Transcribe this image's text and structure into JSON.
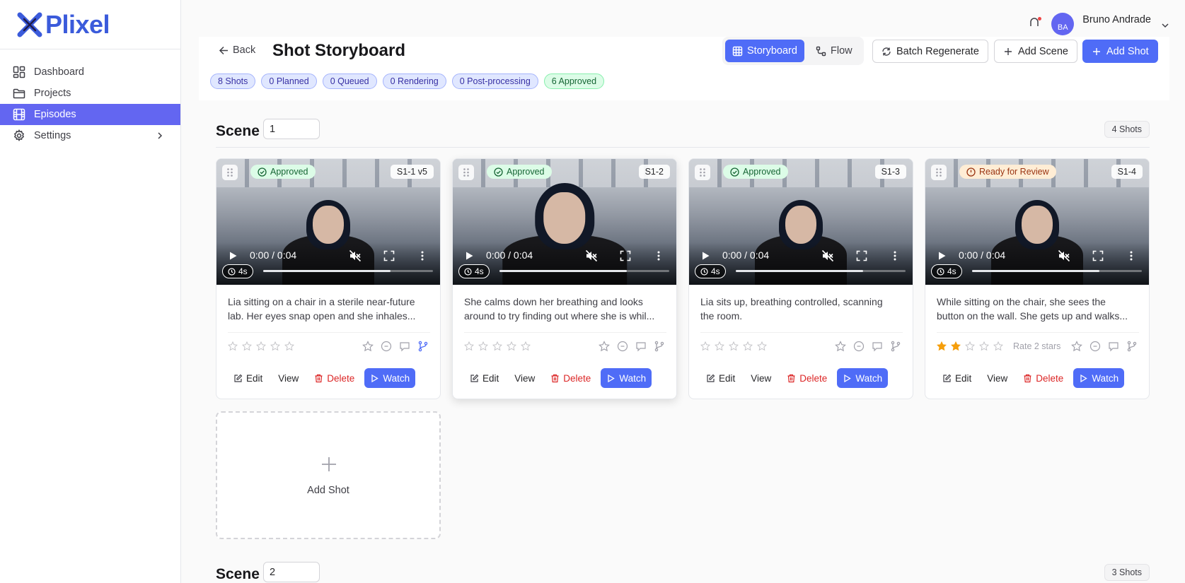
{
  "app": {
    "name": "Plixel"
  },
  "sidebar": {
    "items": [
      {
        "label": "Dashboard",
        "icon": "dashboard-icon"
      },
      {
        "label": "Projects",
        "icon": "folder-icon"
      },
      {
        "label": "Episodes",
        "icon": "film-icon",
        "active": true
      },
      {
        "label": "Settings",
        "icon": "gear-icon"
      }
    ]
  },
  "user": {
    "initials": "BA",
    "name": "Bruno Andrade"
  },
  "header": {
    "back_label": "Back",
    "title": "Shot Storyboard",
    "views": {
      "storyboard": "Storyboard",
      "flow": "Flow"
    },
    "batch_label": "Batch Regenerate",
    "add_scene_label": "Add Scene",
    "add_shot_label": "Add Shot",
    "chips": [
      "8 Shots",
      "0 Planned",
      "0 Queued",
      "0 Rendering",
      "0 Post-processing",
      "6 Approved"
    ]
  },
  "scenes": [
    {
      "label": "Scene",
      "number": "1",
      "count": "4 Shots"
    },
    {
      "label": "Scene",
      "number": "2",
      "count": "3 Shots"
    }
  ],
  "shots": [
    {
      "status": "Approved",
      "status_type": "approved",
      "id": "S1-1 v5",
      "time": "0:00 / 0:04",
      "duration": "4s",
      "progress": 0.75,
      "desc1": "Lia sitting on a chair in a sterile near-future",
      "desc2": "lab. Her eyes snap open and she inhales...",
      "rating": 0,
      "rate_label": ""
    },
    {
      "status": "Approved",
      "status_type": "approved",
      "id": "S1-2",
      "time": "0:00 / 0:04",
      "duration": "4s",
      "progress": 0.75,
      "desc1": "She calms down her breathing and looks",
      "desc2": "around to try finding out where she is whil...",
      "rating": 0,
      "rate_label": ""
    },
    {
      "status": "Approved",
      "status_type": "approved",
      "id": "S1-3",
      "time": "0:00 / 0:04",
      "duration": "4s",
      "progress": 0.75,
      "desc1": "Lia sits up, breathing controlled, scanning",
      "desc2": "the room.",
      "rating": 0,
      "rate_label": ""
    },
    {
      "status": "Ready for Review",
      "status_type": "review",
      "id": "S1-4",
      "time": "0:00 / 0:04",
      "duration": "4s",
      "progress": 0.75,
      "desc1": "While sitting on the chair, she sees the",
      "desc2": "button on the wall. She gets up and walks...",
      "rating": 2,
      "rate_label": "Rate 2 stars"
    }
  ],
  "card_actions": {
    "edit": "Edit",
    "view": "View",
    "delete": "Delete",
    "watch": "Watch"
  },
  "add_shot_card": {
    "label": "Add Shot"
  },
  "colors": {
    "accent": "#4f6cf7",
    "sidebar_active": "#6366f1",
    "approved": "#166534",
    "review": "#9a3412",
    "star_filled": "#f59e0b"
  }
}
